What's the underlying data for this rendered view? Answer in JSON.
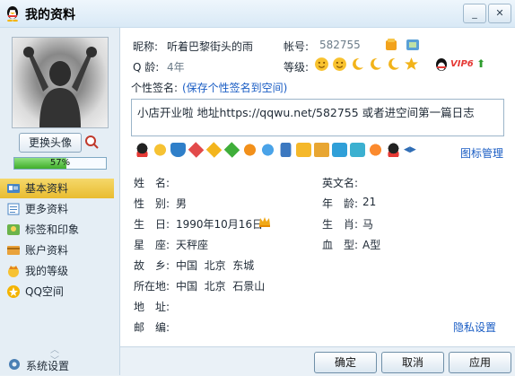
{
  "window": {
    "title": "我的资料"
  },
  "left": {
    "change_avatar": "更换头像",
    "progress_text": "57%",
    "progress_fraction": 0.57,
    "nav": [
      {
        "label": "基本资料",
        "icon": "id-card-icon",
        "active": true
      },
      {
        "label": "更多资料",
        "icon": "list-icon",
        "active": false
      },
      {
        "label": "标签和印象",
        "icon": "tag-icon",
        "active": false
      },
      {
        "label": "账户资料",
        "icon": "account-icon",
        "active": false
      },
      {
        "label": "我的等级",
        "icon": "crown-icon",
        "active": false
      },
      {
        "label": "QQ空间",
        "icon": "qzone-icon",
        "active": false
      }
    ],
    "settings_label": "系统设置"
  },
  "profile": {
    "nickname_label": "昵称:",
    "nickname": "听着巴黎街头的雨",
    "account_label": "帐号:",
    "account": "582755",
    "qage_label": "Q 龄:",
    "qage": "4年",
    "level_label": "等级:",
    "vip_text": "VIP6",
    "signature_label": "个性签名:",
    "signature_link": "(保存个性签名到空间)",
    "signature": "小店开业啦 地址https://qqwu.net/582755 或者进空间第一篇日志",
    "icon_manage": "图标管理"
  },
  "details": {
    "name_label": "姓　名:",
    "name": "",
    "english_name_label": "英文名:",
    "english_name": "",
    "gender_label": "性　别:",
    "gender": "男",
    "age_label": "年　龄:",
    "age": "21",
    "birthday_label": "生　日:",
    "birthday": "1990年10月16日",
    "zodiac_label": "生　肖:",
    "zodiac": "马",
    "constellation_label": "星　座:",
    "constellation": "天秤座",
    "blood_label": "血　型:",
    "blood": "A型",
    "hometown_label": "故　乡:",
    "hometown": "中国  北京  东城",
    "location_label": "所在地:",
    "location": "中国  北京  石景山",
    "address_label": "地　址:",
    "address": "",
    "zip_label": "邮　编:",
    "zip": "",
    "privacy_link": "隐私设置"
  },
  "buttons": {
    "ok": "确定",
    "cancel": "取消",
    "apply": "应用"
  }
}
